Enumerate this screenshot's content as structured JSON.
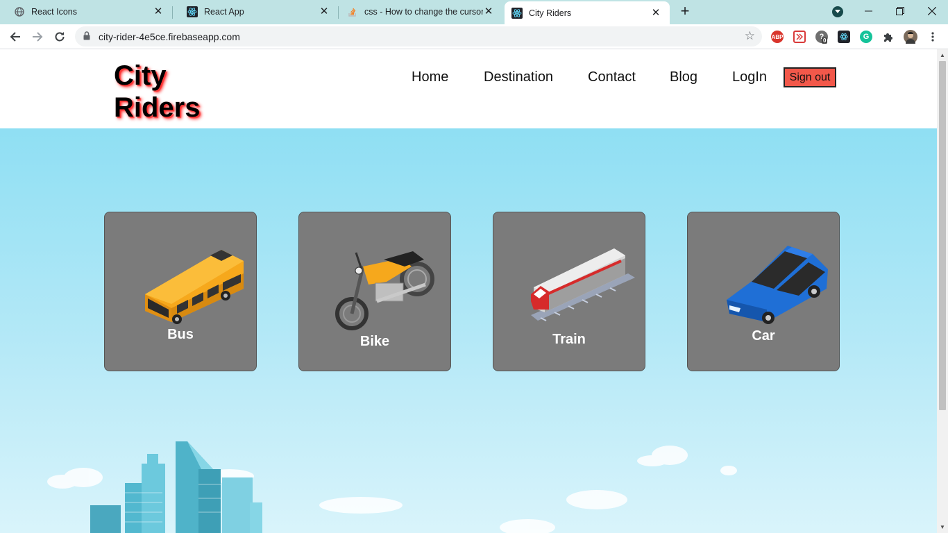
{
  "browser": {
    "tabs": [
      {
        "title": "React Icons",
        "icon": "globe-icon"
      },
      {
        "title": "React App",
        "icon": "react-icon"
      },
      {
        "title": "css - How to change the cursor in",
        "icon": "stackoverflow-icon"
      },
      {
        "title": "City Riders",
        "icon": "react-icon",
        "active": true
      }
    ],
    "url": "city-rider-4e5ce.firebaseapp.com",
    "extension_badge": "0",
    "abp_label": "ABP",
    "grammarly_label": "G"
  },
  "site": {
    "logo_line1": "City",
    "logo_line2": "Riders",
    "nav": [
      "Home",
      "Destination",
      "Contact",
      "Blog",
      "LogIn"
    ],
    "signout_label": "Sign out"
  },
  "vehicles": [
    {
      "label": "Bus",
      "icon": "bus-icon"
    },
    {
      "label": "Bike",
      "icon": "motorcycle-icon"
    },
    {
      "label": "Train",
      "icon": "train-icon"
    },
    {
      "label": "Car",
      "icon": "car-icon"
    }
  ],
  "colors": {
    "accent_signout": "#f2584a",
    "card_bg": "#7b7b7b",
    "logo_glow": "#ff2a2a",
    "sky_top": "#8fdff3"
  }
}
